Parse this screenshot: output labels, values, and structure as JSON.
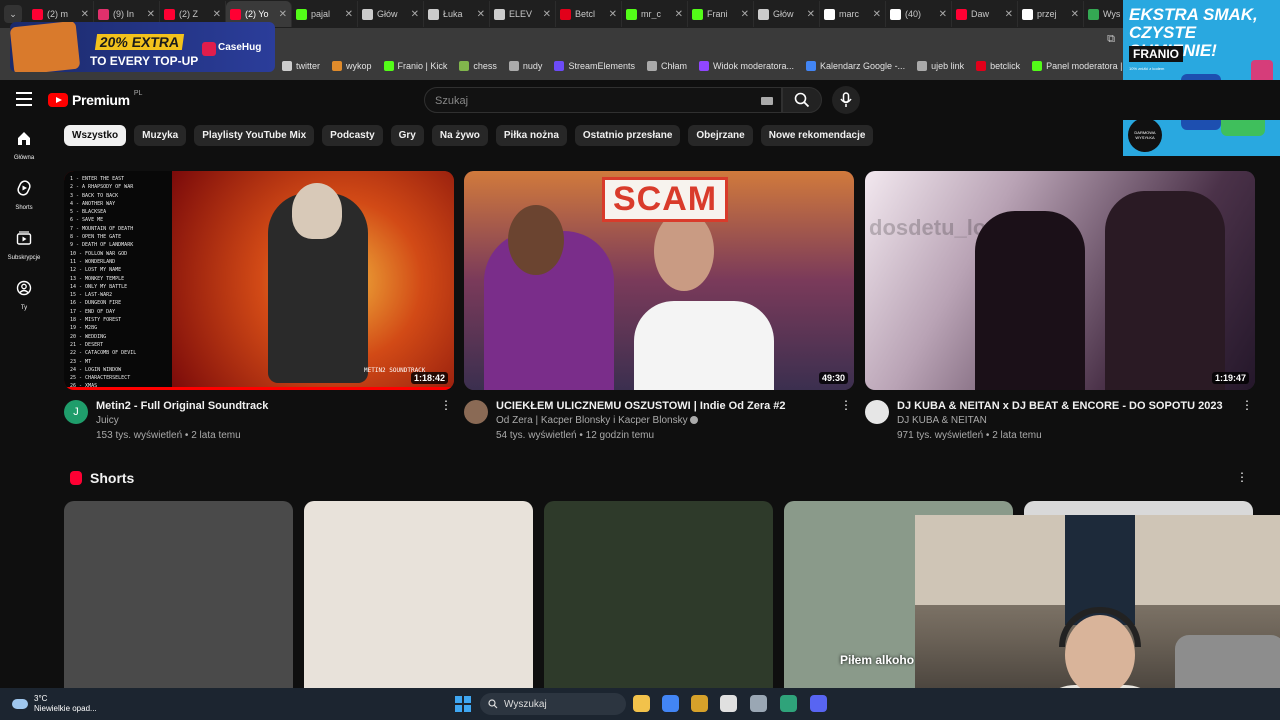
{
  "browser": {
    "tabs": [
      {
        "title": "(2) m",
        "color": "#ff0033"
      },
      {
        "title": "(9) In",
        "color": "#e1306c"
      },
      {
        "title": "(2) Z",
        "color": "#ff0033"
      },
      {
        "title": "(2) Yo",
        "color": "#ff0033"
      },
      {
        "title": "pajal",
        "color": "#53fc18"
      },
      {
        "title": "Głów",
        "color": "#cccccc"
      },
      {
        "title": "Łuka",
        "color": "#cccccc"
      },
      {
        "title": "ELEV",
        "color": "#cccccc"
      },
      {
        "title": "Betcl",
        "color": "#e2001a"
      },
      {
        "title": "mr_c",
        "color": "#53fc18"
      },
      {
        "title": "Frani",
        "color": "#53fc18"
      },
      {
        "title": "Głów",
        "color": "#cccccc"
      },
      {
        "title": "marc",
        "color": "#ffffff"
      },
      {
        "title": "(40)",
        "color": "#ffffff"
      },
      {
        "title": "Daw",
        "color": "#ff0033"
      },
      {
        "title": "przej",
        "color": "#ffffff"
      },
      {
        "title": "Wys",
        "color": "#34a853"
      }
    ],
    "active_tab_index": 3,
    "bookmarks": [
      {
        "label": "twitter",
        "color": "#cccccc"
      },
      {
        "label": "wykop",
        "color": "#e08b2b"
      },
      {
        "label": "Franio | Kick",
        "color": "#53fc18"
      },
      {
        "label": "chess",
        "color": "#81b64c"
      },
      {
        "label": "nudy",
        "color": "#aaaaaa"
      },
      {
        "label": "StreamElements",
        "color": "#6c4bf7"
      },
      {
        "label": "Chłam",
        "color": "#aaaaaa"
      },
      {
        "label": "Widok moderatora...",
        "color": "#9146ff"
      },
      {
        "label": "Kalendarz Google -...",
        "color": "#4285f4"
      },
      {
        "label": "ujeb link",
        "color": "#aaaaaa"
      },
      {
        "label": "betclick",
        "color": "#e2001a"
      },
      {
        "label": "Panel moderatora |...",
        "color": "#53fc18"
      }
    ]
  },
  "ads": {
    "casehug": {
      "promo1": "20% EXTRA",
      "promo2": "TO EVERY TOP-UP",
      "brand": "CaseHug"
    },
    "franio": {
      "headline": "EKSTRA SMAK, CZYSTE SUMIENIE!",
      "brand": "FRANIO",
      "note": "10% zniżki z kodem",
      "badge": "DARMOWA WYSYŁKA"
    }
  },
  "youtube": {
    "logo_text": "Premium",
    "country": "PL",
    "search_placeholder": "Szukaj",
    "sidebar": [
      {
        "label": "Główna",
        "icon": "home-icon"
      },
      {
        "label": "Shorts",
        "icon": "shorts-icon"
      },
      {
        "label": "Subskrypcje",
        "icon": "subscriptions-icon"
      },
      {
        "label": "Ty",
        "icon": "you-icon"
      }
    ],
    "chips": [
      "Wszystko",
      "Muzyka",
      "Playlisty YouTube Mix",
      "Podcasty",
      "Gry",
      "Na żywo",
      "Piłka nożna",
      "Ostatnio przesłane",
      "Obejrzane",
      "Nowe rekomendacje"
    ],
    "active_chip_index": 0,
    "videos": [
      {
        "title": "Metin2 - Full Original Soundtrack",
        "channel": "Juicy",
        "stats": "153 tys. wyświetleń • 2 lata temu",
        "duration": "1:18:42",
        "avatar_letter": "J",
        "avatar_color": "#1f9d6b",
        "watched_fraction": 1.0,
        "verified": false,
        "thumb_text": "METIN2 SOUNDTRACK",
        "tracklist": [
          "1 - ENTER THE EAST",
          "2 - A RHAPSODY OF WAR",
          "3 - BACK TO BACK",
          "4 - ANOTHER WAY",
          "5 - BLACKSEA",
          "6 - SAVE ME",
          "7 - MOUNTAIN OF DEATH",
          "8 - OPEN THE GATE",
          "9 - DEATH OF LANDMARK",
          "10 - FOLLOW WAR GOD",
          "11 - WONDERLAND",
          "12 - LOST MY NAME",
          "13 - MONKEY TEMPLE",
          "14 - ONLY MY BATTLE",
          "15 - LAST-WAR2",
          "16 - DUNGEON FIRE",
          "17 - END OF DAY",
          "18 - MISTY FOREST",
          "19 - M2BG",
          "20 - WEDDING",
          "21 - DESERT",
          "22 - CATACOMB OF DEVIL",
          "23 - MT",
          "24 - LOGIN WINDOW",
          "25 - CHARACTERSELECT",
          "26 - XMAS"
        ]
      },
      {
        "title": "UCIEKŁEM ULICZNEMU OSZUSTOWI | Indie Od Zera #2",
        "channel": "Od Zera | Kacper Blonsky i Kacper Blonsky",
        "stats": "54 tys. wyświetleń • 12 godzin temu",
        "duration": "49:30",
        "avatar_letter": "",
        "avatar_color": "#8a6a55",
        "watched_fraction": 0,
        "verified": true,
        "thumb_text": "SCAM"
      },
      {
        "title": "DJ KUBA & NEITAN x DJ BEAT & ENCORE - DO SOPOTU 2023",
        "channel": "DJ KUBA & NEITAN",
        "stats": "971 tys. wyświetleń • 2 lata temu",
        "duration": "1:19:47",
        "avatar_letter": "",
        "avatar_color": "#e6e6e6",
        "watched_fraction": 0,
        "verified": false,
        "thumb_text": "dosdetu_lodz"
      }
    ],
    "shorts_title": "Shorts",
    "shorts": [
      {
        "caption": "",
        "color": "#4a4a4a"
      },
      {
        "caption": "",
        "color": "#e8e2da"
      },
      {
        "caption": "",
        "color": "#2e3a2a"
      },
      {
        "caption": "Piłem alkoho",
        "color": "#8a9a8a"
      },
      {
        "caption": "",
        "color": "#d9d9d9"
      }
    ]
  },
  "taskbar": {
    "temp": "3°C",
    "weather_desc": "Niewielkie opad...",
    "search_label": "Wyszukaj",
    "apps": [
      {
        "name": "file-explorer-icon",
        "color": "#f2c24b"
      },
      {
        "name": "chrome-icon",
        "color": "#4285f4"
      },
      {
        "name": "app-icon-1",
        "color": "#d6a12a"
      },
      {
        "name": "app-icon-2",
        "color": "#e0e0e0"
      },
      {
        "name": "settings-icon",
        "color": "#9aa7b4"
      },
      {
        "name": "browser-icon",
        "color": "#2fa37a"
      },
      {
        "name": "discord-icon",
        "color": "#5865f2"
      }
    ]
  }
}
